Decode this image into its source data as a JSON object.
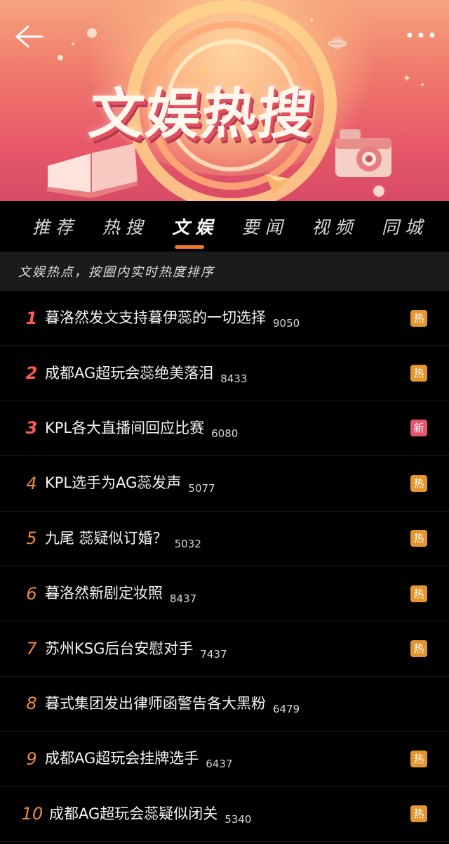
{
  "header": {
    "title": "文娱热搜",
    "back_icon": "back-arrow-icon",
    "more_icon": "more-dots-icon"
  },
  "tabs": [
    {
      "label": "推荐",
      "active": false
    },
    {
      "label": "热搜",
      "active": false
    },
    {
      "label": "文娱",
      "active": true
    },
    {
      "label": "要闻",
      "active": false
    },
    {
      "label": "视频",
      "active": false
    },
    {
      "label": "同城",
      "active": false
    }
  ],
  "subtitle": "文娱热点，按圈内实时热度排序",
  "colors": {
    "accent": "#f57a2a",
    "hot_badge": "#e3962f",
    "new_badge": "#e0566c",
    "top_rank": "#ff5a4e",
    "rank": "#f08a3c"
  },
  "items": [
    {
      "rank": "1",
      "topic": "暮洛然发文支持暮伊蕊的一切选择",
      "count": "9050",
      "badge": "热"
    },
    {
      "rank": "2",
      "topic": "成都AG超玩会蕊绝美落泪",
      "count": "8433",
      "badge": "热"
    },
    {
      "rank": "3",
      "topic": "KPL各大直播间回应比赛",
      "count": "6080",
      "badge": "新"
    },
    {
      "rank": "4",
      "topic": "KPL选手为AG蕊发声",
      "count": "5077",
      "badge": "热"
    },
    {
      "rank": "5",
      "topic": "九尾 蕊疑似订婚？",
      "count": "5032",
      "badge": "热"
    },
    {
      "rank": "6",
      "topic": "暮洛然新剧定妆照",
      "count": "8437",
      "badge": "热"
    },
    {
      "rank": "7",
      "topic": "苏州KSG后台安慰对手",
      "count": "7437",
      "badge": "热"
    },
    {
      "rank": "8",
      "topic": "暮式集团发出律师函警告各大黑粉",
      "count": "6479",
      "badge": ""
    },
    {
      "rank": "9",
      "topic": "成都AG超玩会挂牌选手",
      "count": "6437",
      "badge": "热"
    },
    {
      "rank": "10",
      "topic": "成都AG超玩会蕊疑似闭关",
      "count": "5340",
      "badge": "热"
    }
  ]
}
